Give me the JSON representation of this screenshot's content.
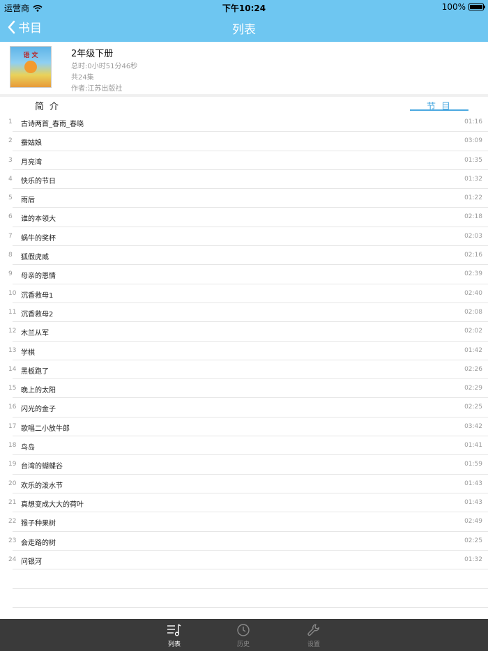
{
  "status_bar": {
    "carrier": "运营商",
    "time": "下午10:24",
    "battery": "100%"
  },
  "nav": {
    "back_label": "书目",
    "title": "列表"
  },
  "book": {
    "title": "2年级下册",
    "total_duration": "总时:0小时51分46秒",
    "episode_count": "共24集",
    "author": "作者:江苏出版社",
    "cover_text": "语 文"
  },
  "tabs": {
    "intro": "简介",
    "episodes": "节目",
    "active": "episodes"
  },
  "colors": {
    "accent": "#6ec6f1",
    "tab_active": "#4aa8e0",
    "tabbar_bg": "#3a3a3a"
  },
  "episodes": [
    {
      "num": "1",
      "title": "古诗两首_春雨_春晓",
      "duration": "01:16"
    },
    {
      "num": "2",
      "title": "蚕姑娘",
      "duration": "03:09"
    },
    {
      "num": "3",
      "title": "月亮湾",
      "duration": "01:35"
    },
    {
      "num": "4",
      "title": "快乐的节日",
      "duration": "01:32"
    },
    {
      "num": "5",
      "title": "雨后",
      "duration": "01:22"
    },
    {
      "num": "6",
      "title": "谁的本领大",
      "duration": "02:18"
    },
    {
      "num": "7",
      "title": "蜗牛的奖杯",
      "duration": "02:03"
    },
    {
      "num": "8",
      "title": "狐假虎威",
      "duration": "02:16"
    },
    {
      "num": "9",
      "title": "母亲的恩情",
      "duration": "02:39"
    },
    {
      "num": "10",
      "title": "沉香救母1",
      "duration": "02:40"
    },
    {
      "num": "11",
      "title": "沉香救母2",
      "duration": "02:08"
    },
    {
      "num": "12",
      "title": "木兰从军",
      "duration": "02:02"
    },
    {
      "num": "13",
      "title": "学棋",
      "duration": "01:42"
    },
    {
      "num": "14",
      "title": "黑板跑了",
      "duration": "02:26"
    },
    {
      "num": "15",
      "title": "晚上的太阳",
      "duration": "02:29"
    },
    {
      "num": "16",
      "title": "闪光的金子",
      "duration": "02:25"
    },
    {
      "num": "17",
      "title": "歌唱二小放牛郎",
      "duration": "03:42"
    },
    {
      "num": "18",
      "title": "鸟岛",
      "duration": "01:41"
    },
    {
      "num": "19",
      "title": "台湾的蝴蝶谷",
      "duration": "01:59"
    },
    {
      "num": "20",
      "title": "欢乐的泼水节",
      "duration": "01:43"
    },
    {
      "num": "21",
      "title": "真想变成大大的荷叶",
      "duration": "01:43"
    },
    {
      "num": "22",
      "title": "猴子种果树",
      "duration": "02:49"
    },
    {
      "num": "23",
      "title": "会走路的树",
      "duration": "02:25"
    },
    {
      "num": "24",
      "title": "问银河",
      "duration": "01:32"
    }
  ],
  "tabbar": [
    {
      "label": "列表",
      "icon": "list-music-icon",
      "active": true
    },
    {
      "label": "历史",
      "icon": "clock-icon",
      "active": false
    },
    {
      "label": "设置",
      "icon": "wrench-icon",
      "active": false
    }
  ]
}
